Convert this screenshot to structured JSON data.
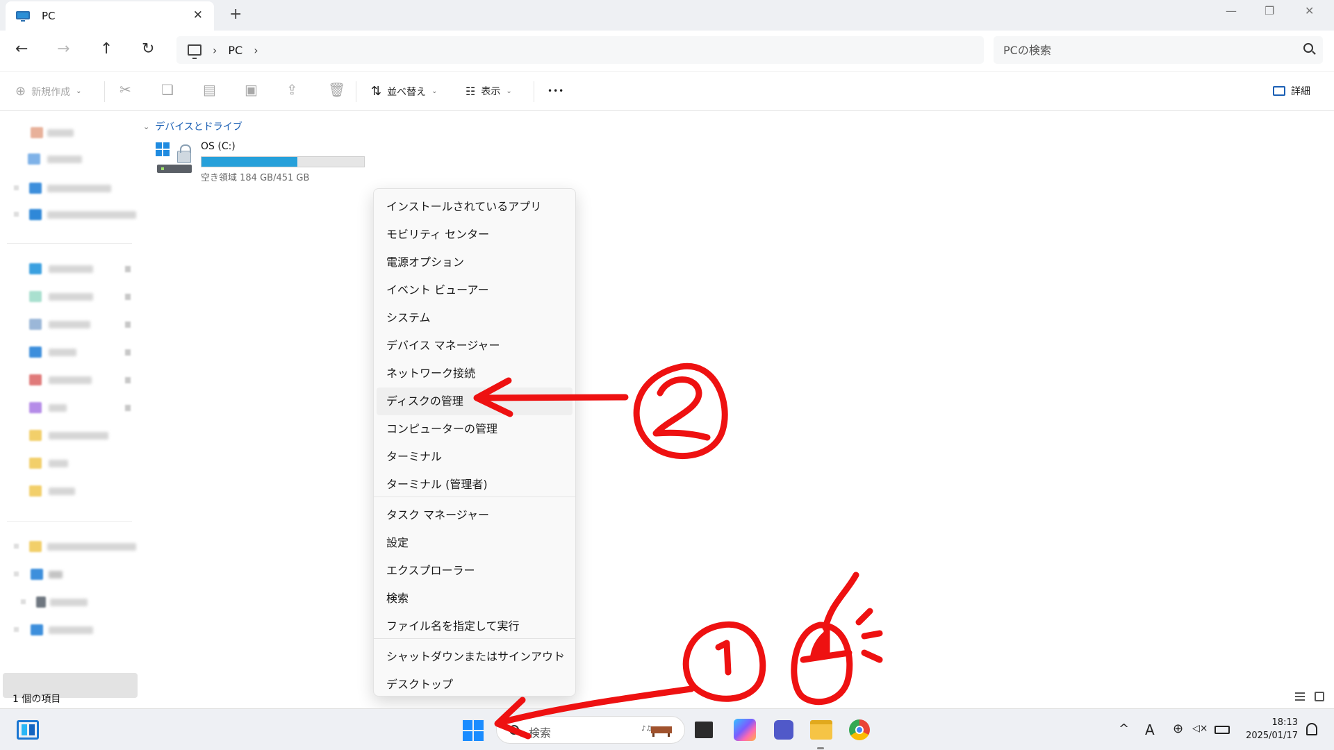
{
  "window": {
    "tab_title": "PC",
    "new_tab": "+",
    "minimize": "—",
    "restore": "❐",
    "close": "✕"
  },
  "nav": {
    "back": "←",
    "forward": "→",
    "up": "↑",
    "refresh": "↻",
    "breadcrumb": [
      "PC"
    ],
    "chevron": "›",
    "search_placeholder": "PCの検索"
  },
  "toolbar": {
    "new_label": "新規作成",
    "sort_label": "並べ替え",
    "view_label": "表示",
    "more": "•••",
    "details_label": "詳細",
    "icons": [
      "cut-icon",
      "copy-icon",
      "paste-icon",
      "rename-icon",
      "share-icon",
      "delete-icon"
    ]
  },
  "main": {
    "group_title": "デバイスとドライブ",
    "drive": {
      "name": "OS (C:)",
      "free_text": "空き領域 184 GB/451 GB",
      "used_fraction": 0.59
    }
  },
  "status": {
    "item_count": "1 個の項目"
  },
  "context_menu": {
    "items": [
      "インストールされているアプリ",
      "モビリティ センター",
      "電源オプション",
      "イベント ビューアー",
      "システム",
      "デバイス マネージャー",
      "ネットワーク接続",
      "ディスクの管理",
      "コンピューターの管理",
      "ターミナル",
      "ターミナル (管理者)",
      "タスク マネージャー",
      "設定",
      "エクスプローラー",
      "検索",
      "ファイル名を指定して実行",
      "シャットダウンまたはサインアウト",
      "デスクトップ"
    ],
    "highlighted": "ディスクの管理",
    "submenu_arrow": "›"
  },
  "taskbar": {
    "search_label": "検索",
    "time": "18:13",
    "date": "2025/01/17",
    "tray": {
      "chevron": "^",
      "ime": "A",
      "globe": "⊕",
      "volume": "◁×"
    }
  },
  "annotations": {
    "step1": "①",
    "step2": "②",
    "color": "#ee1111"
  }
}
